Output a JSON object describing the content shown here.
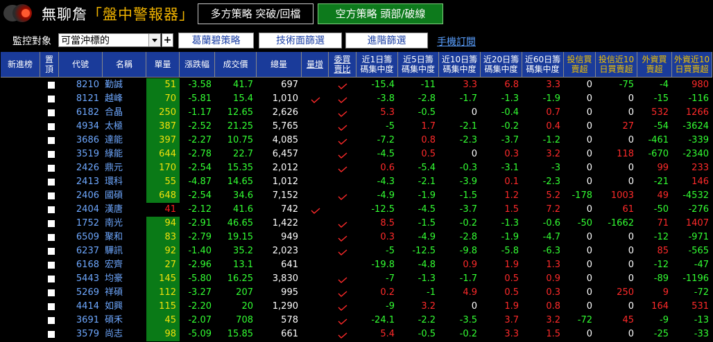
{
  "header": {
    "title_main": "無聊詹",
    "title_accent": "「盤中警報器」",
    "long_strategy": "多方策略  突破/回檔",
    "short_strategy": "空方策略  頭部/破線"
  },
  "controls": {
    "monitor_label": "監控對象",
    "monitor_value": "可當沖標的",
    "plus_label": "+",
    "buttons": [
      "葛蘭碧策略",
      "技術面篩選",
      "進階篩選"
    ],
    "mobile_link": "手機訂閱"
  },
  "colors": {
    "header_bg": "#1a3b9a",
    "lot_bg": "#0a7a17",
    "up": "#ff2a2a",
    "down": "#33ff33",
    "short_btn": "#0d7a1c"
  },
  "columns": [
    {
      "lines": [
        "新進榜"
      ]
    },
    {
      "lines": [
        "置",
        "頂"
      ]
    },
    {
      "lines": [
        "代號"
      ]
    },
    {
      "lines": [
        "名稱"
      ]
    },
    {
      "lines": [
        "單量"
      ]
    },
    {
      "lines": [
        "漲跌幅"
      ]
    },
    {
      "lines": [
        "成交價"
      ]
    },
    {
      "lines": [
        "總量"
      ]
    },
    {
      "lines": [
        "量增"
      ],
      "underline": true
    },
    {
      "lines": [
        "委買",
        "賣比"
      ],
      "underline": true
    },
    {
      "lines": [
        "近1日籌",
        "碼集中度"
      ]
    },
    {
      "lines": [
        "近5日籌",
        "碼集中度"
      ]
    },
    {
      "lines": [
        "近10日籌",
        "碼集中度"
      ]
    },
    {
      "lines": [
        "近20日籌",
        "碼集中度"
      ]
    },
    {
      "lines": [
        "近60日籌",
        "碼集中度"
      ]
    },
    {
      "lines": [
        "投信買",
        "賣超"
      ],
      "yellow": true
    },
    {
      "lines": [
        "投信近10",
        "日買賣超"
      ],
      "yellow": true
    },
    {
      "lines": [
        "外資買",
        "賣超"
      ],
      "yellow": true
    },
    {
      "lines": [
        "外資近10",
        "日買賣超"
      ],
      "yellow": true
    }
  ],
  "rows": [
    {
      "code": "8210",
      "name": "勤誠",
      "lot": "51",
      "chg": "-3.58",
      "price": "41.7",
      "vol": "697",
      "vinc": false,
      "ratio": true,
      "c1": "-15.4",
      "c5": "-11",
      "c10": "3.3",
      "c20": "6.8",
      "c60": "3.3",
      "it": "0",
      "it10": "-75",
      "fi": "-4",
      "fi10": "980"
    },
    {
      "code": "8121",
      "name": "越峰",
      "lot": "70",
      "chg": "-5.81",
      "price": "15.4",
      "vol": "1,010",
      "vinc": true,
      "ratio": true,
      "c1": "-3.8",
      "c5": "-2.8",
      "c10": "-1.7",
      "c20": "-1.3",
      "c60": "-1.9",
      "it": "0",
      "it10": "0",
      "fi": "-15",
      "fi10": "-116"
    },
    {
      "code": "6182",
      "name": "合晶",
      "lot": "250",
      "chg": "-1.17",
      "price": "12.65",
      "vol": "2,626",
      "vinc": false,
      "ratio": true,
      "c1": "5.3",
      "c5": "-0.5",
      "c10": "0",
      "c20": "-0.4",
      "c60": "0.7",
      "it": "0",
      "it10": "0",
      "fi": "532",
      "fi10": "1266"
    },
    {
      "code": "4934",
      "name": "太極",
      "lot": "387",
      "chg": "-2.52",
      "price": "21.25",
      "vol": "5,765",
      "vinc": false,
      "ratio": true,
      "c1": "-5",
      "c5": "1.7",
      "c10": "-2.1",
      "c20": "-0.2",
      "c60": "0.4",
      "it": "0",
      "it10": "27",
      "fi": "-54",
      "fi10": "-3624"
    },
    {
      "code": "3686",
      "name": "達能",
      "lot": "397",
      "chg": "-2.27",
      "price": "10.75",
      "vol": "4,085",
      "vinc": false,
      "ratio": true,
      "c1": "-7.2",
      "c5": "0.8",
      "c10": "-2.3",
      "c20": "-3.7",
      "c60": "-1.2",
      "it": "0",
      "it10": "0",
      "fi": "-461",
      "fi10": "-339"
    },
    {
      "code": "3519",
      "name": "綠能",
      "lot": "644",
      "chg": "-2.78",
      "price": "22.7",
      "vol": "6,457",
      "vinc": false,
      "ratio": true,
      "c1": "-4.5",
      "c5": "0.5",
      "c10": "0",
      "c20": "0.3",
      "c60": "3.2",
      "it": "0",
      "it10": "118",
      "fi": "-670",
      "fi10": "-2340"
    },
    {
      "code": "2426",
      "name": "鼎元",
      "lot": "170",
      "chg": "-2.54",
      "price": "15.35",
      "vol": "2,012",
      "vinc": false,
      "ratio": true,
      "c1": "0.6",
      "c5": "-5.4",
      "c10": "-0.3",
      "c20": "-3.1",
      "c60": "-3",
      "it": "0",
      "it10": "0",
      "fi": "99",
      "fi10": "233"
    },
    {
      "code": "2413",
      "name": "環科",
      "lot": "55",
      "chg": "-4.87",
      "price": "14.65",
      "vol": "1,012",
      "vinc": false,
      "ratio": false,
      "c1": "-4.3",
      "c5": "-2.1",
      "c10": "-3.9",
      "c20": "0.1",
      "c60": "-2.3",
      "it": "0",
      "it10": "0",
      "fi": "-21",
      "fi10": "146"
    },
    {
      "code": "2406",
      "name": "國碩",
      "lot": "648",
      "chg": "-2.54",
      "price": "34.6",
      "vol": "7,152",
      "vinc": false,
      "ratio": true,
      "c1": "-4.9",
      "c5": "-1.9",
      "c10": "-1.5",
      "c20": "1.2",
      "c60": "5.2",
      "it": "-178",
      "it10": "1003",
      "fi": "49",
      "fi10": "-4532"
    },
    {
      "code": "2404",
      "name": "漢唐",
      "lot": "41",
      "lotRed": true,
      "chg": "-2.12",
      "price": "41.6",
      "vol": "742",
      "vinc": true,
      "ratio": false,
      "c1": "-12.5",
      "c5": "-4.5",
      "c10": "-3.7",
      "c20": "1.5",
      "c60": "7.2",
      "it": "0",
      "it10": "61",
      "fi": "-50",
      "fi10": "-276"
    },
    {
      "code": "1752",
      "name": "南光",
      "lot": "94",
      "chg": "-2.91",
      "price": "46.65",
      "vol": "1,422",
      "vinc": false,
      "ratio": true,
      "c1": "8.5",
      "c5": "-1.5",
      "c10": "-0.2",
      "c20": "-1.3",
      "c60": "-0.6",
      "it": "-50",
      "it10": "-1662",
      "fi": "71",
      "fi10": "1407"
    },
    {
      "code": "6509",
      "name": "聚和",
      "lot": "83",
      "chg": "-2.79",
      "price": "19.15",
      "vol": "949",
      "vinc": false,
      "ratio": true,
      "c1": "0.3",
      "c5": "-4.9",
      "c10": "-2.8",
      "c20": "-1.9",
      "c60": "-4.7",
      "it": "0",
      "it10": "0",
      "fi": "-12",
      "fi10": "-971"
    },
    {
      "code": "6237",
      "name": "驊訊",
      "lot": "92",
      "chg": "-1.40",
      "price": "35.2",
      "vol": "2,023",
      "vinc": false,
      "ratio": true,
      "c1": "-5",
      "c5": "-12.5",
      "c10": "-9.8",
      "c20": "-5.8",
      "c60": "-6.3",
      "it": "0",
      "it10": "0",
      "fi": "85",
      "fi10": "-565"
    },
    {
      "code": "6168",
      "name": "宏齊",
      "lot": "27",
      "chg": "-2.96",
      "price": "13.1",
      "vol": "641",
      "vinc": false,
      "ratio": false,
      "c1": "-19.8",
      "c5": "-4.8",
      "c10": "0.9",
      "c20": "1.9",
      "c60": "1.3",
      "it": "0",
      "it10": "0",
      "fi": "-12",
      "fi10": "-47"
    },
    {
      "code": "5443",
      "name": "均豪",
      "lot": "145",
      "chg": "-5.80",
      "price": "16.25",
      "vol": "3,830",
      "vinc": false,
      "ratio": true,
      "c1": "-7",
      "c5": "-1.3",
      "c10": "-1.7",
      "c20": "0.5",
      "c60": "0.9",
      "it": "0",
      "it10": "0",
      "fi": "-89",
      "fi10": "-1196"
    },
    {
      "code": "5269",
      "name": "祥碩",
      "lot": "112",
      "chg": "-3.27",
      "price": "207",
      "vol": "995",
      "vinc": false,
      "ratio": true,
      "c1": "0.2",
      "c5": "-1",
      "c10": "4.9",
      "c20": "0.5",
      "c60": "0.3",
      "it": "0",
      "it10": "250",
      "fi": "9",
      "fi10": "-72"
    },
    {
      "code": "4414",
      "name": "如興",
      "lot": "115",
      "chg": "-2.20",
      "price": "20",
      "vol": "1,290",
      "vinc": false,
      "ratio": true,
      "c1": "-9",
      "c5": "3.2",
      "c10": "0",
      "c20": "1.9",
      "c60": "0.8",
      "it": "0",
      "it10": "0",
      "fi": "164",
      "fi10": "531"
    },
    {
      "code": "3691",
      "name": "碩禾",
      "lot": "45",
      "chg": "-2.07",
      "price": "708",
      "vol": "578",
      "vinc": false,
      "ratio": true,
      "c1": "-24.1",
      "c5": "-2.2",
      "c10": "-3.5",
      "c20": "3.7",
      "c60": "3.2",
      "it": "-72",
      "it10": "45",
      "fi": "-9",
      "fi10": "-13"
    },
    {
      "code": "3579",
      "name": "尚志",
      "lot": "98",
      "chg": "-5.09",
      "price": "15.85",
      "vol": "661",
      "vinc": false,
      "ratio": true,
      "c1": "5.4",
      "c5": "-0.5",
      "c10": "-0.2",
      "c20": "3.3",
      "c60": "1.5",
      "it": "0",
      "it10": "0",
      "fi": "-25",
      "fi10": "-33"
    }
  ]
}
